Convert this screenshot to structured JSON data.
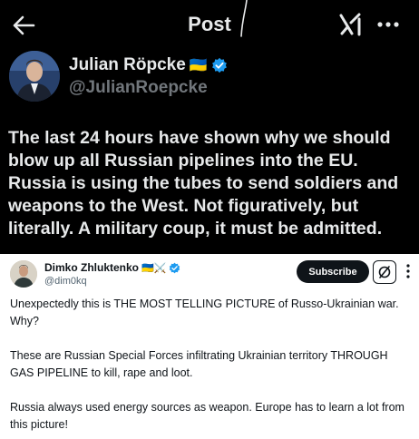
{
  "header": {
    "title": "Post",
    "back_icon": "arrow-left-icon",
    "grok_icon": "grok-icon",
    "more_icon": "more-horizontal-icon"
  },
  "post": {
    "author_name": "Julian Röpcke",
    "author_flag": "🇺🇦",
    "author_handle": "@JulianRoepcke",
    "verified_icon": "verified-badge-icon",
    "text": "The last 24 hours have shown why we should blow up all Russian pipelines into the EU. Russia is using the tubes to send soldiers and weapons to the West. Not figuratively, but literally. A military coup, it must be admitted."
  },
  "embedded": {
    "author_name": "Dimko Zhluktenko",
    "author_emojis": "🇺🇦⚔️",
    "author_handle": "@dim0kq",
    "subscribe_label": "Subscribe",
    "paragraphs": [
      "Unexpectedly this is THE MOST TELLING PICTURE of Russo-Ukrainian war. Why?",
      "These are Russian Special Forces infiltrating Ukrainian territory THROUGH GAS PIPELINE to kill, rape and loot.",
      "Russia always used energy sources as weapon. Europe has to learn a lot from this picture!"
    ]
  },
  "colors": {
    "dark_bg": "#000000",
    "light_text": "#e7e9ea",
    "muted": "#71767b",
    "verified_blue": "#1d9bf0"
  }
}
